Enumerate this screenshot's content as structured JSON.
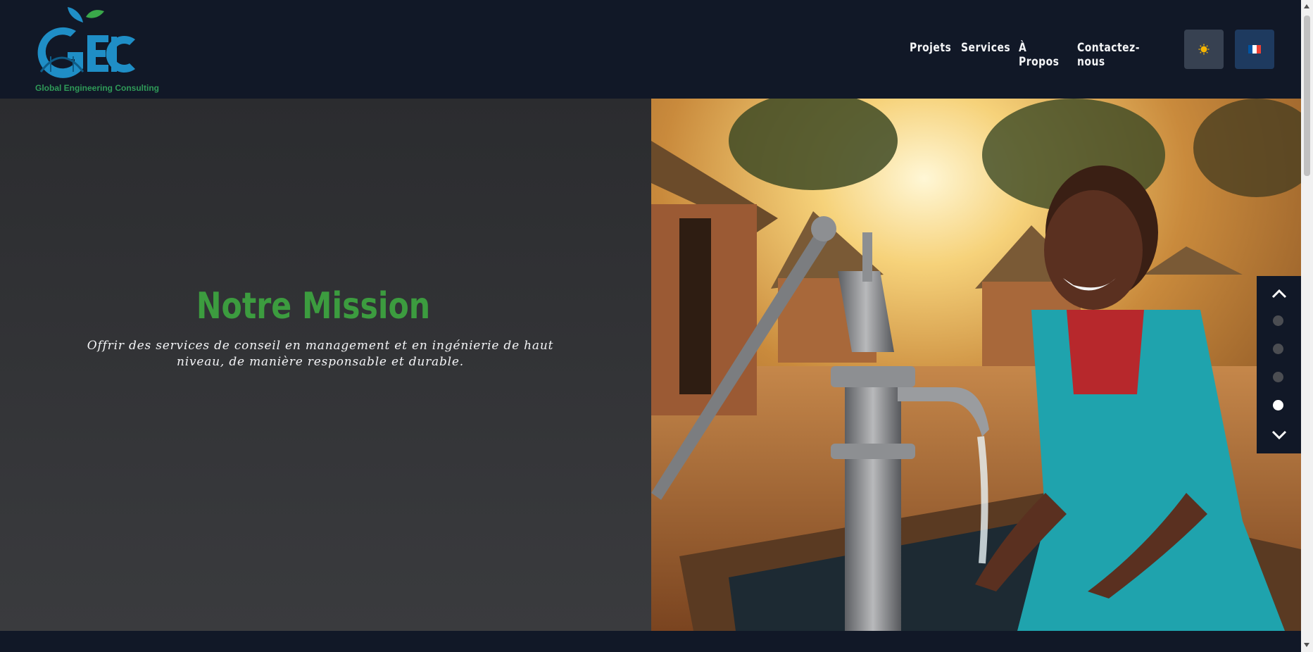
{
  "brand": {
    "logo_letters": "GEC",
    "tagline": "Global Engineering Consulting"
  },
  "nav": {
    "items": [
      "Projets",
      "Services",
      "À Propos",
      "Contactez-nous"
    ]
  },
  "controls": {
    "theme_icon": "sun-icon",
    "language_icon": "french-flag-icon"
  },
  "mission": {
    "title": "Notre Mission",
    "text": "Offrir des services de conseil en management et en ingénierie de haut niveau, de manière responsable et durable."
  },
  "slider": {
    "total_slides": 4,
    "active_index": 4
  },
  "colors": {
    "background": "#111827",
    "accent_green": "#3c9c3f",
    "logo_blue": "#1f8ec6"
  }
}
